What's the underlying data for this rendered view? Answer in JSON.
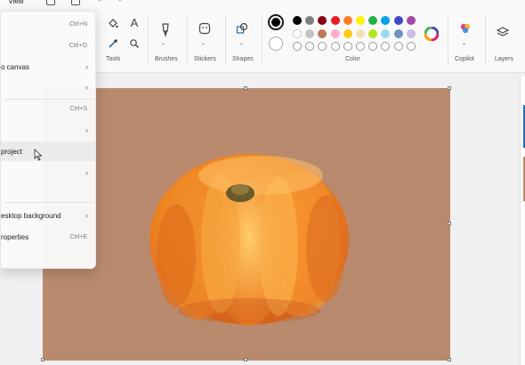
{
  "menubar": {
    "view_label": "View"
  },
  "ribbon": {
    "groups": {
      "tools": "Tools",
      "brushes": "Brushes",
      "stickers": "Stickers",
      "shapes": "Shapes",
      "color": "Color",
      "copilot": "Copilot",
      "layers": "Layers"
    },
    "tools_text_glyph": "A",
    "primary_color": "#000000",
    "secondary_color": "#ffffff",
    "palette_row1": [
      "#000000",
      "#7f7f7f",
      "#880015",
      "#ed1c24",
      "#ff7f27",
      "#fff200",
      "#22b14c",
      "#00a2e8",
      "#3f48cc",
      "#a349a4"
    ],
    "palette_row2": [
      "#ffffff",
      "#c3c3c3",
      "#b97a57",
      "#ffaec9",
      "#ffc90e",
      "#efe4b0",
      "#b5e61d",
      "#99d9ea",
      "#7092be",
      "#c8bfe7"
    ]
  },
  "menu": {
    "items": [
      {
        "label": "",
        "shortcut": "Ctrl+N",
        "submenu": false
      },
      {
        "label": "",
        "shortcut": "Ctrl+O",
        "submenu": false
      },
      {
        "label": "o canvas",
        "shortcut": "",
        "submenu": true
      },
      {
        "label": "",
        "shortcut": "",
        "submenu": true
      },
      {
        "label": "",
        "shortcut": "Ctrl+S",
        "submenu": false
      },
      {
        "label": "",
        "shortcut": "",
        "submenu": true
      },
      {
        "label": "project",
        "shortcut": "",
        "submenu": false
      },
      {
        "label": "",
        "shortcut": "",
        "submenu": true
      },
      {
        "label": "esktop background",
        "shortcut": "",
        "submenu": true
      },
      {
        "label": "roperties",
        "shortcut": "Ctrl+E",
        "submenu": false
      }
    ]
  },
  "canvas": {
    "background_color": "#b98a6e",
    "subject": "pumpkin"
  }
}
